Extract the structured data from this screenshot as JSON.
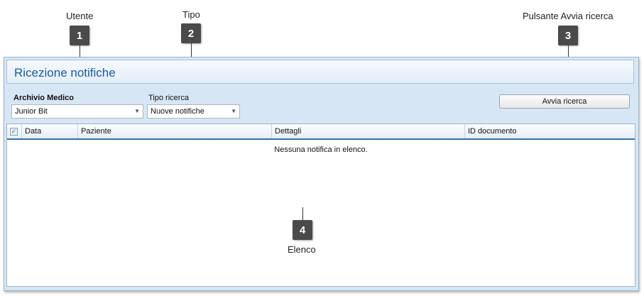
{
  "callouts": [
    {
      "number": "1",
      "label": "Utente"
    },
    {
      "number": "2",
      "label": "Tipo"
    },
    {
      "number": "3",
      "label": "Pulsante Avvia ricerca"
    },
    {
      "number": "4",
      "label": "Elenco"
    }
  ],
  "window": {
    "title": "Ricezione notifiche"
  },
  "filters": {
    "archivio_label": "Archivio Medico",
    "archivio_value": "Junior Bit",
    "tipo_label": "Tipo ricerca",
    "tipo_value": "Nuove notifiche",
    "search_button": "Avvia ricerca"
  },
  "grid": {
    "columns": [
      "Data",
      "Paziente",
      "Dettagli",
      "ID documento"
    ],
    "empty_message": "Nessuna notifica in elenco."
  },
  "icons": {
    "dropdown": "chevron-down-icon",
    "select_all": "checkbox-icon"
  },
  "colors": {
    "title": "#1c5a9c",
    "window_bg": "#d7e6f4",
    "badge": "#4a4a4a"
  }
}
